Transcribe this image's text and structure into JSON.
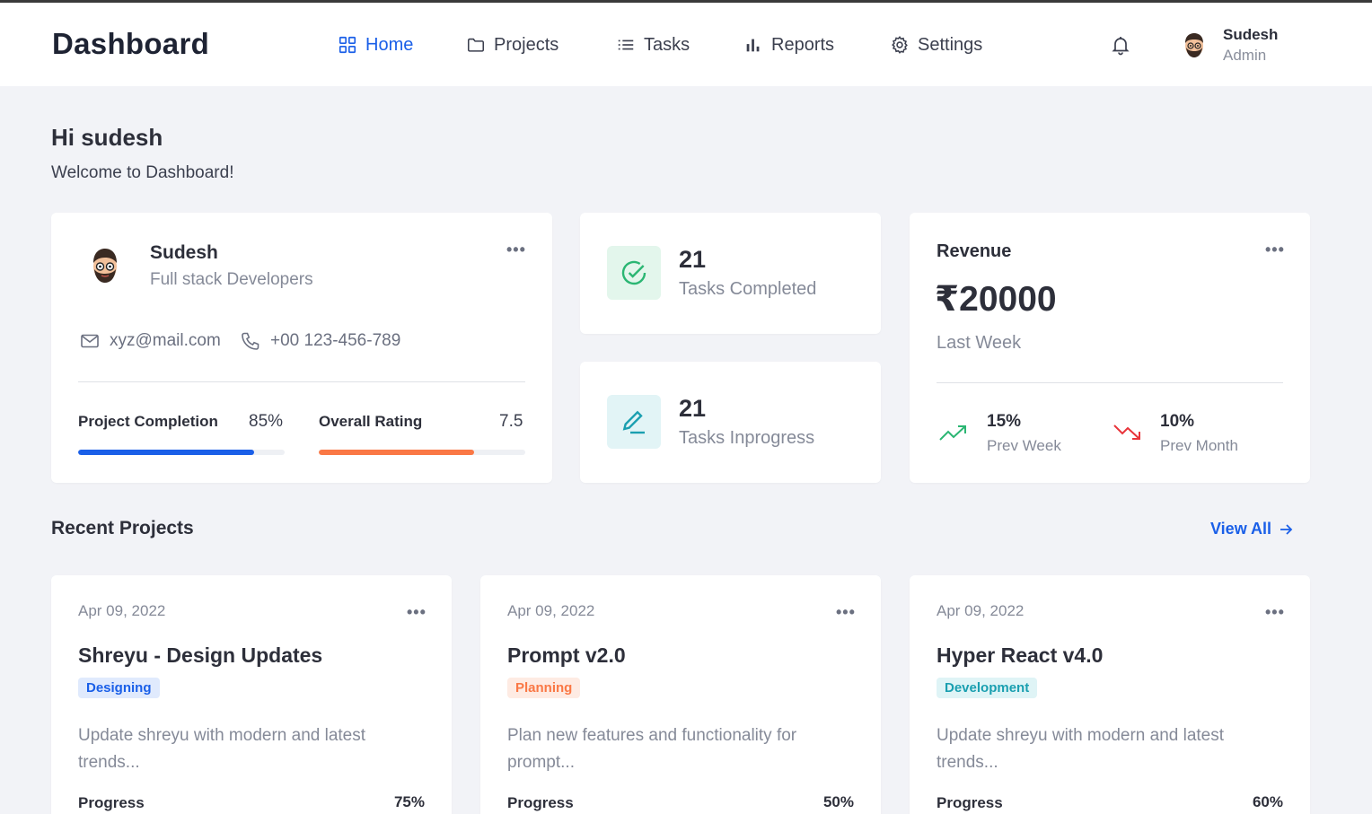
{
  "colors": {
    "primary": "#1a5fe8",
    "orange": "#fa7845",
    "green": "#2bb673",
    "red": "#e8343a",
    "teal": "#1a9fb0"
  },
  "nav": {
    "brand": "Dashboard",
    "items": [
      {
        "label": "Home",
        "icon": "grid-icon",
        "active": true
      },
      {
        "label": "Projects",
        "icon": "folder-icon"
      },
      {
        "label": "Tasks",
        "icon": "list-icon"
      },
      {
        "label": "Reports",
        "icon": "bar-chart-icon"
      },
      {
        "label": "Settings",
        "icon": "gear-icon"
      }
    ],
    "user": {
      "name": "Sudesh",
      "role": "Admin"
    }
  },
  "greeting": {
    "title": "Hi sudesh",
    "subtitle": "Welcome to Dashboard!"
  },
  "profile": {
    "name": "Sudesh",
    "role": "Full stack Developers",
    "email": "xyz@mail.com",
    "phone": "+00 123-456-789",
    "project_completion": {
      "label": "Project Completion",
      "value": "85%",
      "fraction": 0.85
    },
    "overall_rating": {
      "label": "Overall Rating",
      "value": "7.5",
      "fraction": 0.75
    }
  },
  "stats": [
    {
      "value": "21",
      "label": "Tasks Completed",
      "icon": "check-circle-icon"
    },
    {
      "value": "21",
      "label": "Tasks Inprogress",
      "icon": "edit-pen-icon"
    }
  ],
  "revenue": {
    "title": "Revenue",
    "amount": "₹20000",
    "period": "Last Week",
    "trends": [
      {
        "pct": "15%",
        "label": "Prev Week",
        "direction": "up"
      },
      {
        "pct": "10%",
        "label": "Prev Month",
        "direction": "down"
      }
    ]
  },
  "recent": {
    "title": "Recent Projects",
    "view_all": "View All",
    "projects": [
      {
        "date": "Apr 09, 2022",
        "title": "Shreyu - Design Updates",
        "tag": "Designing",
        "desc": "Update shreyu with modern and latest trends...",
        "progress_label": "Progress",
        "progress": "75%"
      },
      {
        "date": "Apr 09, 2022",
        "title": "Prompt v2.0",
        "tag": "Planning",
        "desc": "Plan new features and functionality for prompt...",
        "progress_label": "Progress",
        "progress": "50%"
      },
      {
        "date": "Apr 09, 2022",
        "title": "Hyper React v4.0",
        "tag": "Development",
        "desc": "Update shreyu with modern and latest trends...",
        "progress_label": "Progress",
        "progress": "60%"
      }
    ]
  }
}
